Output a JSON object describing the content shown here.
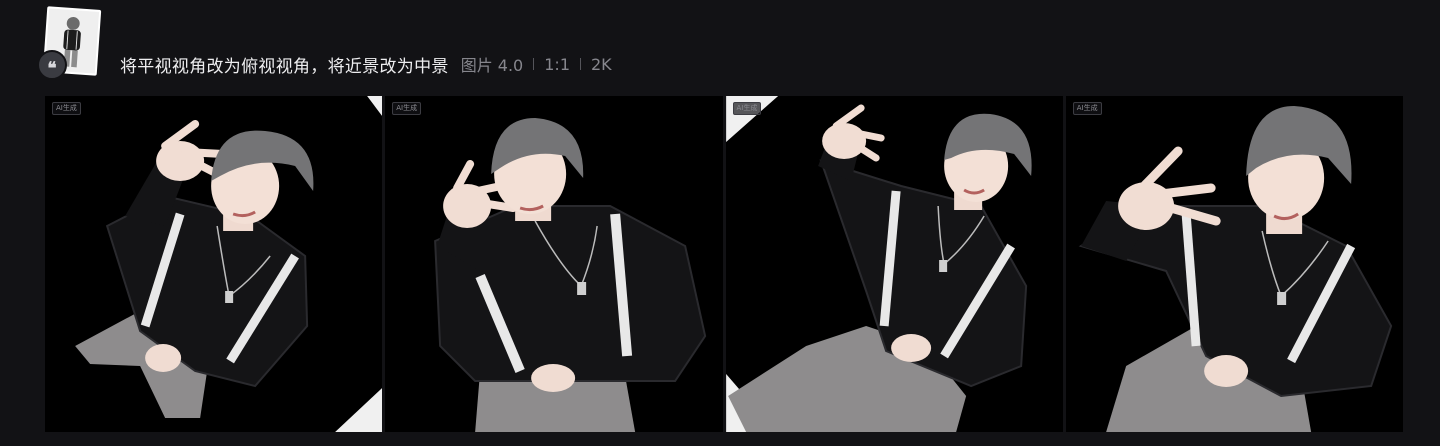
{
  "prompt": {
    "text": "将平视视角改为俯视视角，将近景改为中景",
    "model": "图片 4.0",
    "ratio": "1:1",
    "resolution": "2K"
  },
  "reference": {
    "badge_icon": "quote-icon",
    "badge_glyph": "❝"
  },
  "images": [
    {
      "ai_tag": "AI生成",
      "corner": "top-right-bottom-right"
    },
    {
      "ai_tag": "AI生成",
      "corner": "none"
    },
    {
      "ai_tag": "AI生成",
      "corner": "top-left-bottom-left"
    },
    {
      "ai_tag": "AI生成",
      "corner": "none"
    }
  ],
  "colors": {
    "background": "#121215",
    "prompt_text": "#eeeef0",
    "meta_text": "#86868d",
    "tile_background": "#000000"
  }
}
